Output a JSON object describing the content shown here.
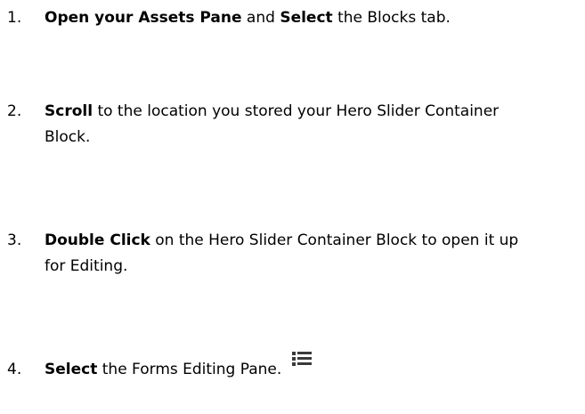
{
  "steps": [
    {
      "number": "1.",
      "parts": [
        {
          "text": "Open your Assets Pane",
          "bold": true
        },
        {
          "text": " and ",
          "bold": false
        },
        {
          "text": "Select",
          "bold": true
        },
        {
          "text": " the Blocks tab.",
          "bold": false
        }
      ]
    },
    {
      "number": "2.",
      "parts": [
        {
          "text": "Scroll",
          "bold": true
        },
        {
          "text": " to the location you stored your Hero Slider Container Block.",
          "bold": false
        }
      ]
    },
    {
      "number": "3.",
      "parts": [
        {
          "text": "Double Click",
          "bold": true
        },
        {
          "text": " on the Hero Slider Container Block to open it up for Editing.",
          "bold": false
        }
      ]
    },
    {
      "number": "4.",
      "parts": [
        {
          "text": "Select",
          "bold": true
        },
        {
          "text": " the Forms Editing Pane.",
          "bold": false
        }
      ],
      "icon": "list-icon"
    }
  ]
}
